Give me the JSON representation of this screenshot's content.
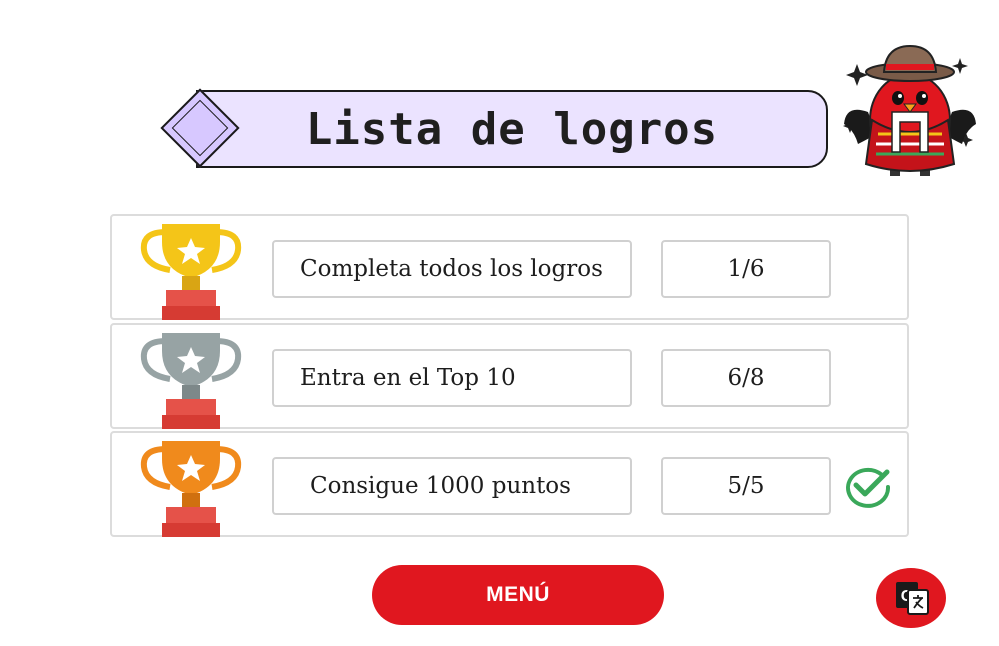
{
  "header": {
    "title": "Lista de logros"
  },
  "achievements": [
    {
      "name": "Completa todos los logros",
      "progress": "1/6",
      "trophy": "gold-trophy-icon",
      "completed": false
    },
    {
      "name": "Entra en el Top 10",
      "progress": "6/8",
      "trophy": "silver-trophy-icon",
      "completed": false
    },
    {
      "name": "Consigue 1000 puntos",
      "progress": "5/5",
      "trophy": "bronze-trophy-icon",
      "completed": true
    }
  ],
  "footer": {
    "menu_label": "MENÚ",
    "translate_icon": "google-translate-icon"
  },
  "colors": {
    "accent": "#e0171f",
    "banner": "#ebe3ff",
    "gold": "#f4c518",
    "silver": "#97a3a4",
    "bronze": "#f08a1c",
    "check": "#3aa85a"
  }
}
